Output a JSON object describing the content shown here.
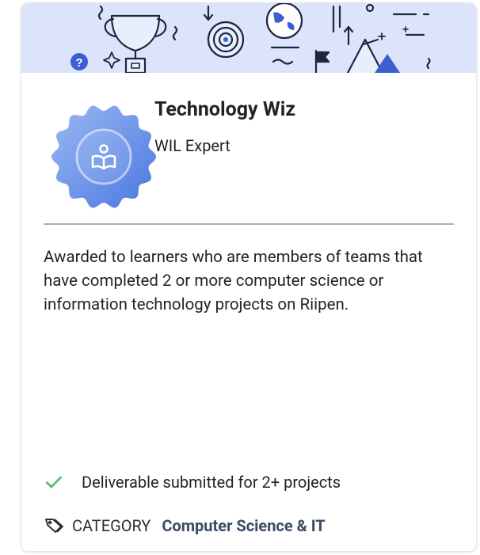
{
  "badge": {
    "title": "Technology Wiz",
    "subtitle": "WIL Expert",
    "icon": "open-book-icon"
  },
  "description": "Awarded to learners who are members of teams that have completed 2 or more computer science or information technology projects on Riipen.",
  "criteria": {
    "icon": "check-icon",
    "text": "Deliverable submitted for 2+ projects"
  },
  "category": {
    "icon": "tag-icon",
    "label": "CATEGORY",
    "value": "Computer Science & IT"
  },
  "colors": {
    "banner_bg": "#dbe4fb",
    "badge_light": "#8fb0f2",
    "badge_dark": "#4a77e0",
    "check_green": "#5bbf76",
    "category_value": "#3b4a66"
  }
}
